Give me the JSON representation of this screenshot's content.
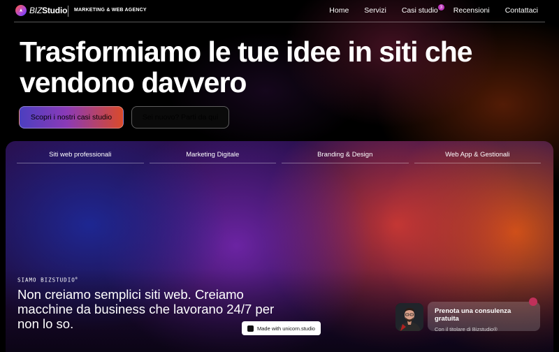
{
  "nav": {
    "logo_biz": "BIZ",
    "logo_studio": "Studio",
    "tagline": "MARKETING & WEB AGENCY",
    "menu": [
      {
        "label": "Home"
      },
      {
        "label": "Servizi"
      },
      {
        "label": "Casi studio",
        "badge": "3"
      },
      {
        "label": "Recensioni"
      },
      {
        "label": "Contattaci"
      }
    ]
  },
  "hero": {
    "title": "Trasformiamo le tue idee in siti che vendono davvero",
    "primary_cta": "Scopri i nostri casi studio",
    "secondary_cta": "Sei nuovo? Parti da qui"
  },
  "showcase": {
    "services": [
      "Siti web professionali",
      "Marketing Digitale",
      "Branding & Design",
      "Web App & Gestionali"
    ],
    "eyebrow": "SIAMO BIZSTUDIO",
    "eyebrow_mark": "®",
    "statement": "Non creiamo semplici siti web. Creiamo macchine da business che lavorano 24/7 per non lo so.",
    "made_with": "Made with unicorn.studio"
  },
  "consult": {
    "title": "Prenota una consulenza gratuita",
    "subtitle": "Con il titolare di Bizstudio®"
  },
  "colors": {
    "accent_gradient_start": "#4c3fbf",
    "accent_gradient_end": "#d94a2a",
    "badge": "#c03ac0"
  }
}
